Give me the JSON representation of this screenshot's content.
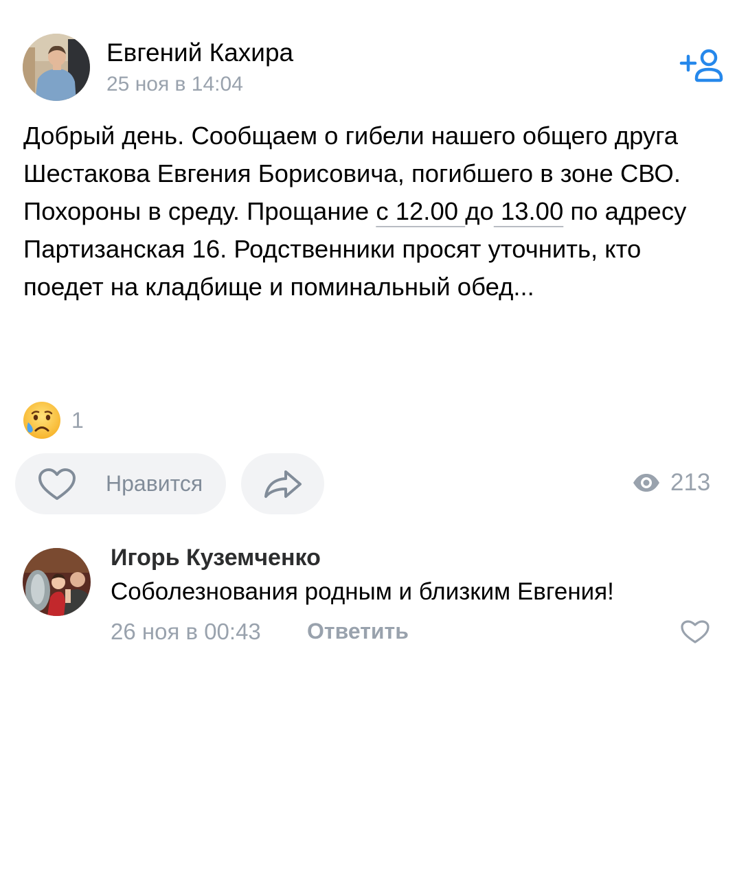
{
  "post": {
    "author": "Евгений Кахира",
    "time": "25 ноя в 14:04",
    "text": {
      "p1": "Добрый день. Сообщаем о гибели нашего общего друга Шестакова Евгения Борисовича, погибшего в зоне СВО.",
      "p2_before": "Похороны в среду. Прощание ",
      "p2_time_from": "с 12.00 ",
      "p2_link_gap": "до",
      "p2_time_to": " 13.00",
      "p2_after": " по адресу Партизанская 16. Родственники просят уточнить, кто поедет на кладбище и поминальный обед..."
    },
    "reaction": {
      "emoji": "😢",
      "count": "1"
    },
    "actions": {
      "like_label": "Нравится",
      "views": "213"
    }
  },
  "comment": {
    "author": "Игорь Куземченко",
    "text": "Соболезнования родным и близким Евгения!",
    "time": "26 ноя в 00:43",
    "reply_label": "Ответить"
  },
  "colors": {
    "accent": "#2688eb",
    "secondary_text": "#99a2ad",
    "button_bg": "#f2f3f5",
    "icon_gray": "#818c99"
  },
  "icons": {
    "add_friend": "add-friend-icon",
    "like": "heart-icon",
    "share": "share-arrow-icon",
    "views": "eye-icon",
    "comment_like": "heart-icon"
  }
}
